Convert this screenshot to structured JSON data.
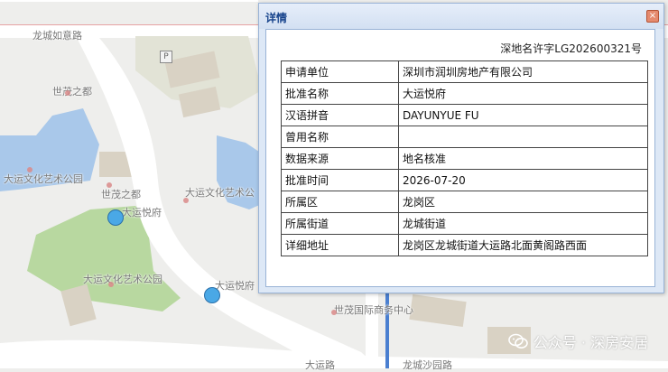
{
  "map": {
    "labels": {
      "top_road": "龙城如意路",
      "shimao_1": "世茂之都",
      "dayun_culture_1": "大运文化艺术公园",
      "shimao_2": "世茂之都",
      "dayun_yuefu_1": "大运悦府",
      "dayun_culture_2": "大运文化艺术公",
      "dayun_culture_3": "大运文化艺术公园",
      "dayun_yuefu_2": "大运悦府",
      "shimao_business": "世茂国际商务中心",
      "dayun_road": "大运路",
      "longcheng_sha_road": "龙城沙园路"
    },
    "parking_symbol": "P",
    "colors": {
      "background": "#eeeeec",
      "green": "#b8d8a0",
      "water": "#a9c8ea",
      "building": "#d9d2c4",
      "road": "#ffffff",
      "marker": "#4aa8e6"
    }
  },
  "panel": {
    "title": "详情",
    "close_icon": "×",
    "permit_no": "深地名许字LG202600321号",
    "rows": [
      {
        "key": "申请单位",
        "value": "深圳市润圳房地产有限公司"
      },
      {
        "key": "批准名称",
        "value": "大运悦府"
      },
      {
        "key": "汉语拼音",
        "value": "DAYUNYUE FU"
      },
      {
        "key": "曾用名称",
        "value": ""
      },
      {
        "key": "数据来源",
        "value": "地名核准"
      },
      {
        "key": "批准时间",
        "value": "2026-07-20"
      },
      {
        "key": "所属区",
        "value": "龙岗区"
      },
      {
        "key": "所属街道",
        "value": "龙城街道"
      },
      {
        "key": "详细地址",
        "value": "龙岗区龙城街道大运路北面黄阁路西面"
      }
    ]
  },
  "watermark": {
    "text": "公众号 · 深房安居",
    "icon": "wechat-icon"
  }
}
